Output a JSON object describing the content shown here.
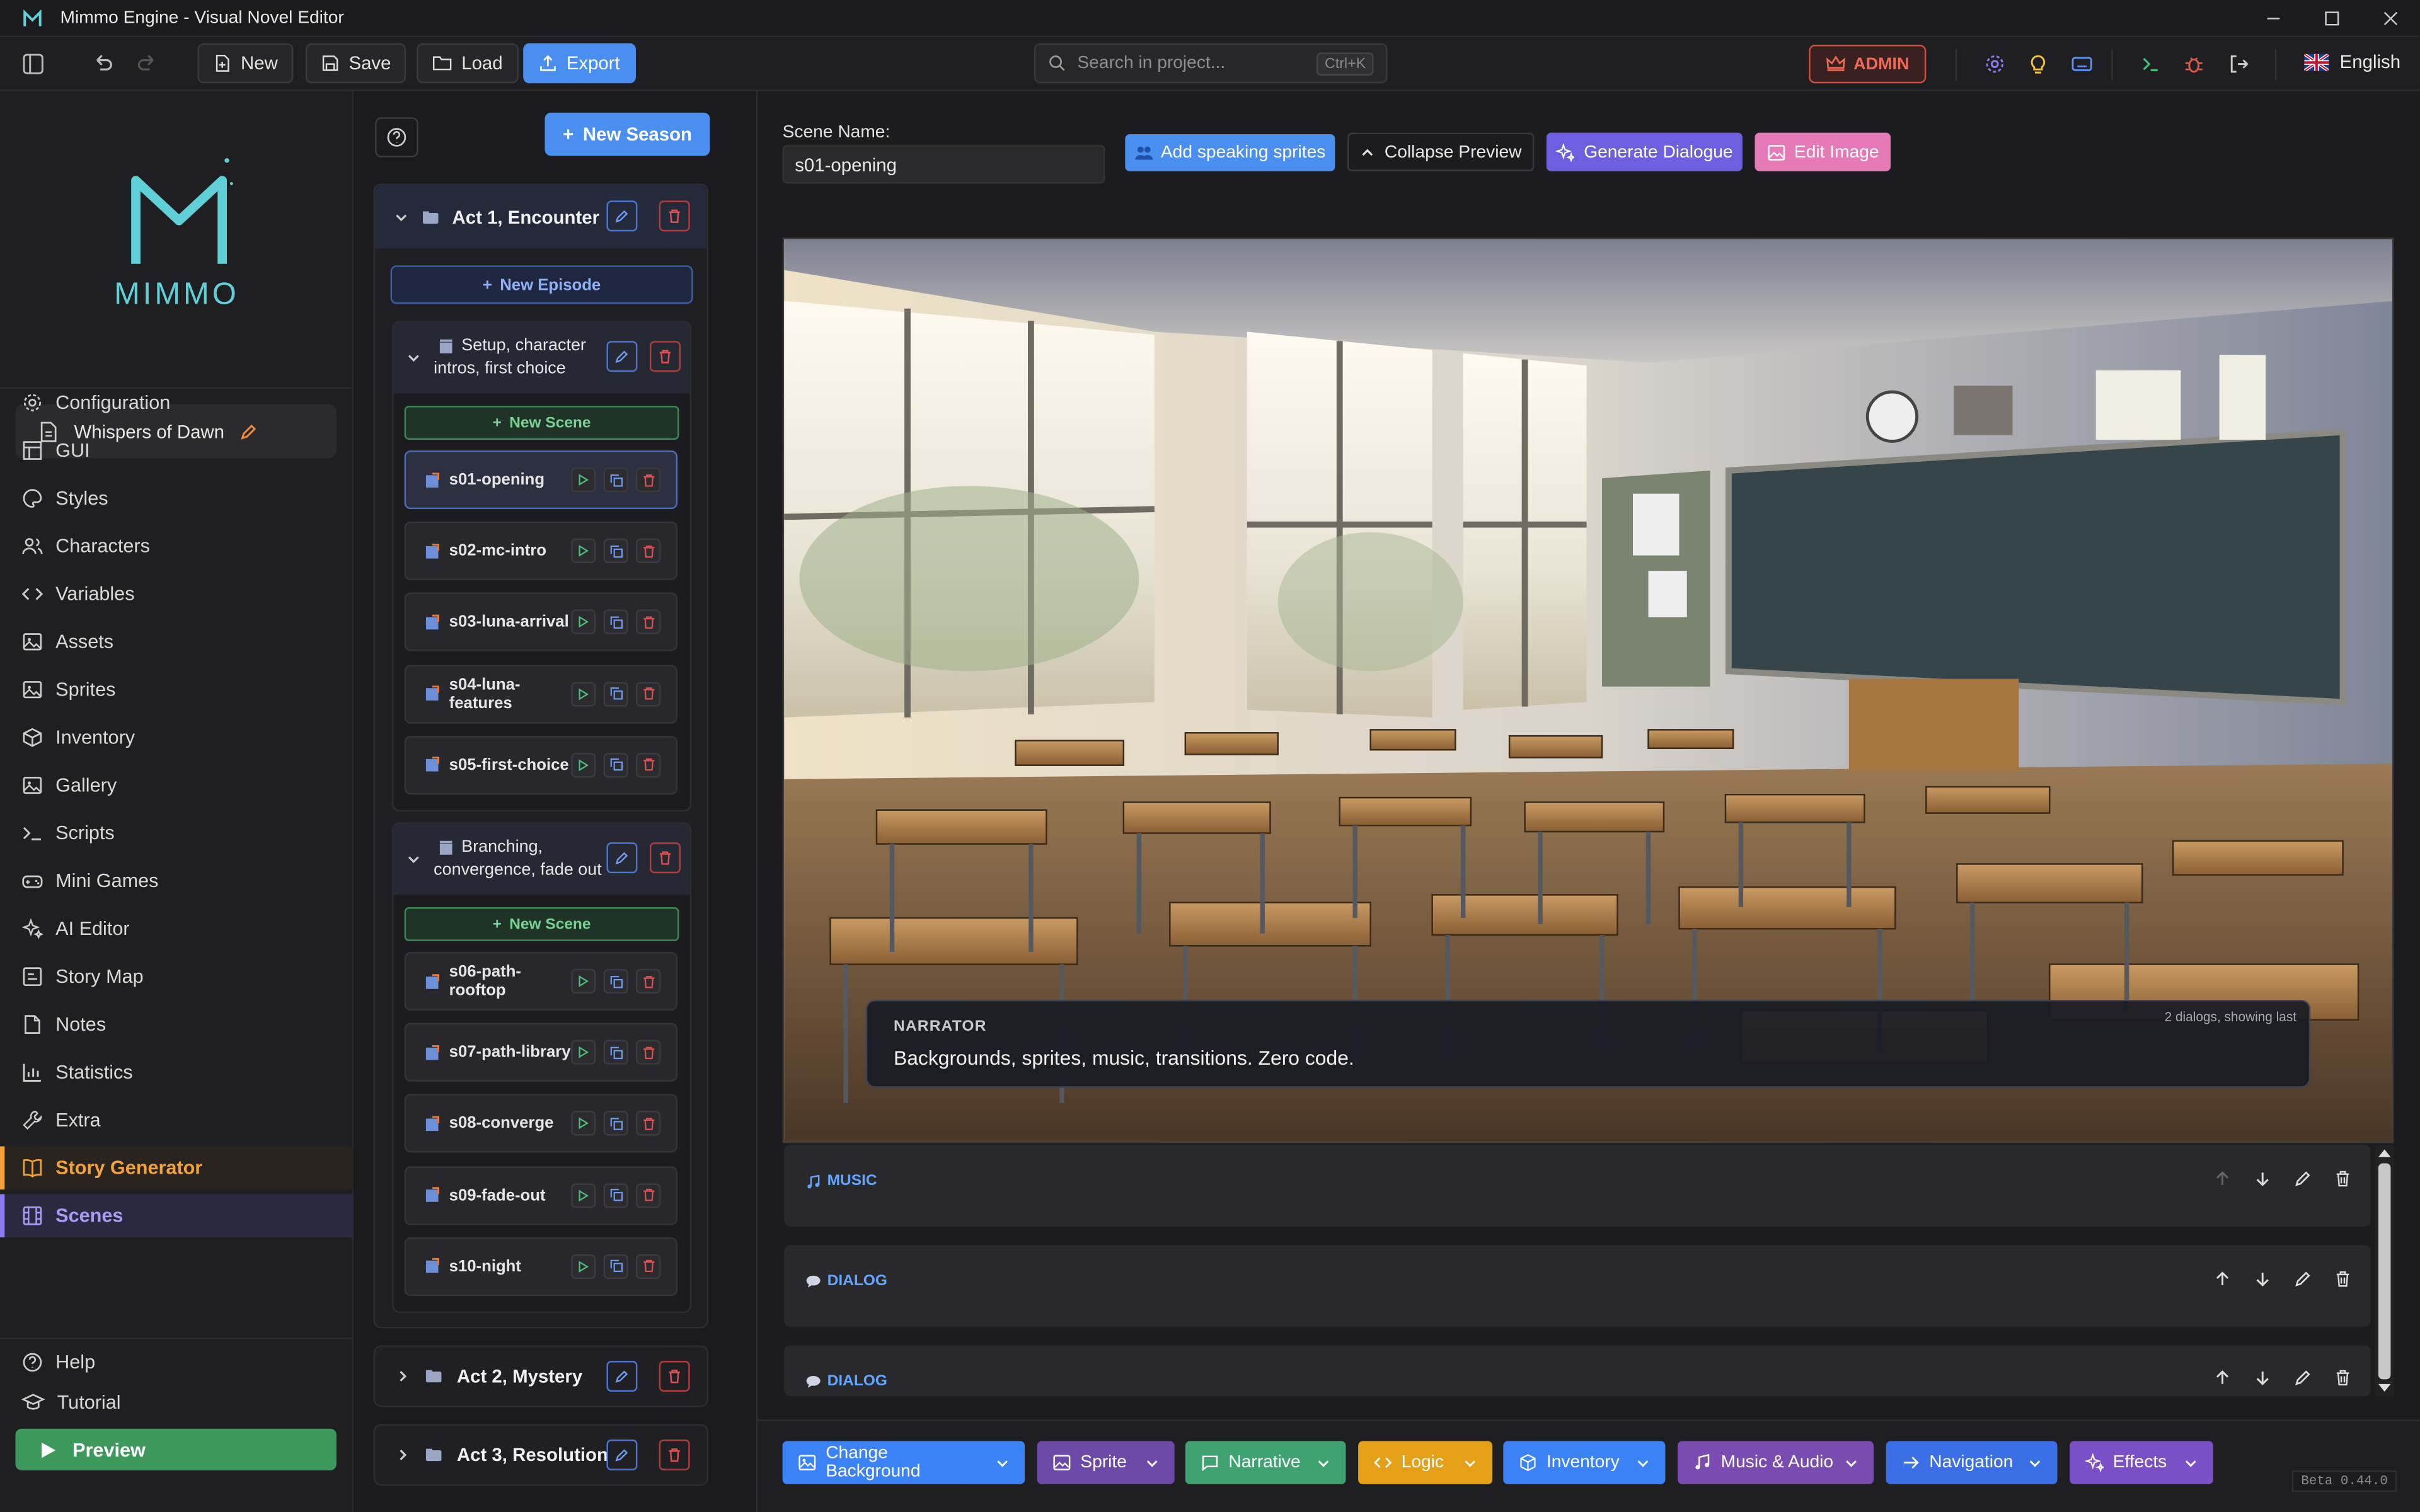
{
  "window": {
    "title": "Mimmo Engine - Visual Novel Editor"
  },
  "toolbar": {
    "new_label": "New",
    "save_label": "Save",
    "load_label": "Load",
    "export_label": "Export",
    "search_placeholder": "Search in project...",
    "search_shortcut": "Ctrl+K",
    "admin_label": "ADMIN",
    "language_label": "English"
  },
  "sidebar": {
    "logo_text": "MIMMO",
    "project_name": "Whispers of Dawn",
    "items": [
      {
        "label": "Configuration",
        "icon": "gear-icon"
      },
      {
        "label": "GUI",
        "icon": "layout-icon"
      },
      {
        "label": "Styles",
        "icon": "palette-icon"
      },
      {
        "label": "Characters",
        "icon": "users-icon"
      },
      {
        "label": "Variables",
        "icon": "code-icon"
      },
      {
        "label": "Assets",
        "icon": "image-icon"
      },
      {
        "label": "Sprites",
        "icon": "image-icon"
      },
      {
        "label": "Inventory",
        "icon": "box-icon"
      },
      {
        "label": "Gallery",
        "icon": "image-icon"
      },
      {
        "label": "Scripts",
        "icon": "terminal-icon"
      },
      {
        "label": "Mini Games",
        "icon": "gamepad-icon"
      },
      {
        "label": "AI Editor",
        "icon": "sparkle-icon"
      },
      {
        "label": "Story Map",
        "icon": "map-icon"
      },
      {
        "label": "Notes",
        "icon": "note-icon"
      },
      {
        "label": "Statistics",
        "icon": "chart-icon"
      },
      {
        "label": "Extra",
        "icon": "wrench-icon"
      },
      {
        "label": "Story Generator",
        "icon": "book-icon"
      },
      {
        "label": "Scenes",
        "icon": "film-icon"
      }
    ],
    "help_label": "Help",
    "tutorial_label": "Tutorial",
    "preview_label": "Preview"
  },
  "episodes": {
    "new_season_label": "New Season",
    "acts": [
      {
        "title": "Act 1, Encounter"
      },
      {
        "title": "Act 2, Mystery"
      },
      {
        "title": "Act 3, Resolution"
      }
    ],
    "new_episode_label": "New Episode",
    "new_scene_label": "New Scene",
    "episode1": {
      "title_line1": "Setup, character",
      "title_line2": "intros, first choice",
      "scenes": [
        "s01-opening",
        "s02-mc-intro",
        "s03-luna-arrival",
        "s04-luna-features",
        "s05-first-choice"
      ]
    },
    "episode2": {
      "title_line1": "Branching,",
      "title_line2": "convergence, fade out",
      "scenes": [
        "s06-path-rooftop",
        "s07-path-library",
        "s08-converge",
        "s09-fade-out",
        "s10-night"
      ]
    }
  },
  "scene": {
    "name_label": "Scene Name:",
    "name_value": "s01-opening",
    "add_sprites_label": "Add speaking sprites",
    "collapse_label": "Collapse Preview",
    "generate_label": "Generate Dialogue",
    "edit_image_label": "Edit Image",
    "preview": {
      "speaker": "NARRATOR",
      "dialog_count": "2 dialogs, showing last",
      "text": "Backgrounds, sprites, music, transitions. Zero code."
    },
    "blocks": [
      "MUSIC",
      "DIALOG",
      "DIALOG"
    ]
  },
  "bottom_toolbar": [
    {
      "label": "Change Background",
      "color": "#3b82f6"
    },
    {
      "label": "Sprite",
      "color": "#6d4aa8"
    },
    {
      "label": "Narrative",
      "color": "#3fa271"
    },
    {
      "label": "Logic",
      "color": "#e5a017"
    },
    {
      "label": "Inventory",
      "color": "#3b82f6"
    },
    {
      "label": "Music & Audio",
      "color": "#7a4bb0"
    },
    {
      "label": "Navigation",
      "color": "#3b6fe8"
    },
    {
      "label": "Effects",
      "color": "#7b4fc5"
    }
  ],
  "version": "Beta 0.44.0"
}
